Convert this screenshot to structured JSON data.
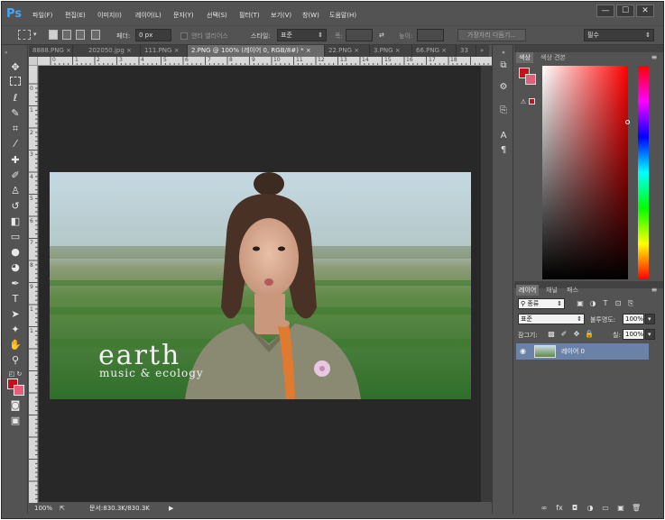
{
  "app": {
    "logo": "Ps"
  },
  "menu": [
    "파일(F)",
    "편집(E)",
    "이미지(I)",
    "레이어(L)",
    "문자(Y)",
    "선택(S)",
    "필터(T)",
    "보기(V)",
    "창(W)",
    "도움말(H)"
  ],
  "window_controls": {
    "minimize": "—",
    "maximize": "☐",
    "close": "✕"
  },
  "options": {
    "feather_label": "페더:",
    "feather_value": "0 px",
    "antialias_label": "앤티 앨리어스",
    "style_label": "스타일:",
    "style_value": "표준",
    "width_label": "폭:",
    "height_label": "높이:",
    "refine_edge": "가장자리 다듬기...",
    "workspace": "필수"
  },
  "tabs": [
    "8888.PNG",
    "202050.jpg",
    "111.PNG",
    "2.PNG @ 100% (레이어 0, RGB/8#) *",
    "22.PNG",
    "3.PNG",
    "66.PNG",
    "33"
  ],
  "tab_close": "×",
  "tab_overflow": "»",
  "ruler_top_ticks": [
    "0",
    "1",
    "2",
    "3",
    "4",
    "5",
    "6",
    "7",
    "8",
    "9",
    "10",
    "11",
    "12",
    "13",
    "14",
    "15",
    "16",
    "17",
    "18"
  ],
  "ruler_left_ticks": [
    "0",
    "1",
    "2",
    "3",
    "4",
    "5",
    "6",
    "7",
    "8",
    "9",
    "1",
    "1"
  ],
  "photo": {
    "title": "earth",
    "subtitle": "music & ecology"
  },
  "status": {
    "zoom": "100%",
    "doc": "문서:830.3K/830.3K"
  },
  "panels": {
    "color_tabs": [
      "색상",
      "색상 견본"
    ],
    "layer_tabs": [
      "레이어",
      "채널",
      "패스"
    ],
    "filter_kind": "종류",
    "blend_mode": "표준",
    "opacity_label": "불투명도:",
    "opacity_value": "100%",
    "lock_label": "잠그기:",
    "fill_label": "칠:",
    "fill_value": "100%",
    "layer_name": "레이어 0",
    "footer_icons": [
      "∞",
      "fx",
      "◘",
      "◑",
      "▭",
      "▣",
      "🗑"
    ]
  },
  "colors": {
    "foreground": "#c4121a",
    "background": "#e0607a",
    "accent": "#3ea8ff"
  }
}
